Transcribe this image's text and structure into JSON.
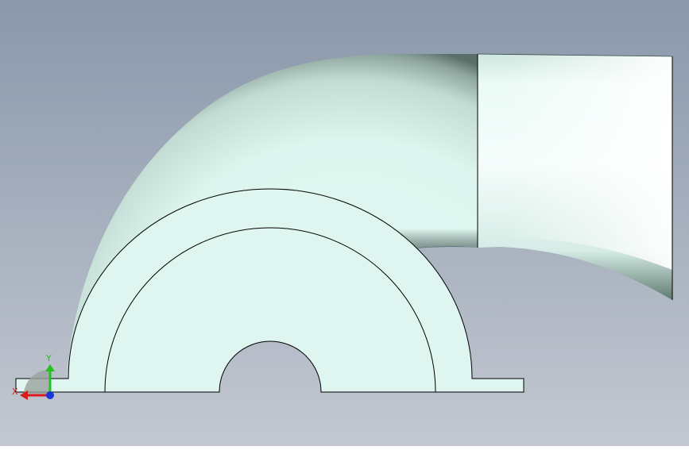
{
  "viewport": {
    "background_top": "#8a98ab",
    "background_bottom": "#c3c8d1",
    "model_face_color": "#dff6f0",
    "model_edge_color": "#000000"
  },
  "triad": {
    "x_label": "X",
    "y_label": "Y",
    "x_color": "#d81b1b",
    "y_color": "#1fc21f",
    "z_color": "#1a36d8"
  }
}
